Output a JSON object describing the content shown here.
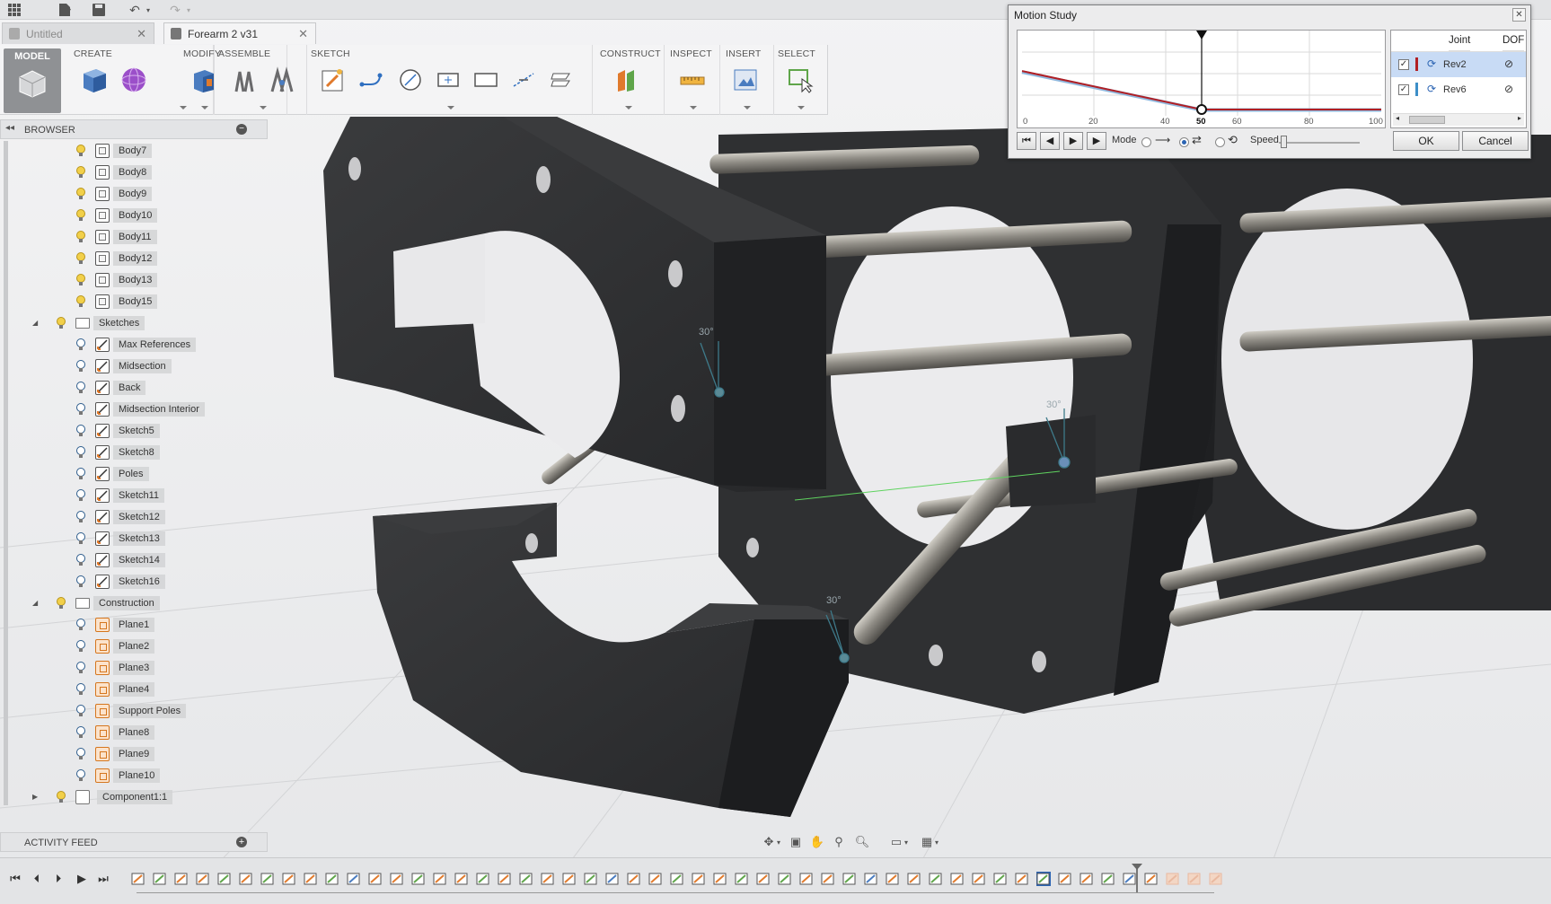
{
  "tabs": [
    {
      "label": "Untitled",
      "active": false
    },
    {
      "label": "Forearm 2 v31",
      "active": true
    }
  ],
  "toolbar": {
    "model_label": "MODEL",
    "groups": [
      "CREATE",
      "MODIFY",
      "ASSEMBLE",
      "SKETCH",
      "CONSTRUCT",
      "INSPECT",
      "INSERT",
      "SELECT"
    ]
  },
  "browser": {
    "title": "BROWSER",
    "bodies": [
      "Body7",
      "Body8",
      "Body9",
      "Body10",
      "Body11",
      "Body12",
      "Body13",
      "Body15"
    ],
    "sketches_folder": "Sketches",
    "sketches": [
      "Max References",
      "Midsection",
      "Back",
      "Midsection Interior",
      "Sketch5",
      "Sketch8",
      "Poles",
      "Sketch11",
      "Sketch12",
      "Sketch13",
      "Sketch14",
      "Sketch16"
    ],
    "construction_folder": "Construction",
    "planes": [
      "Plane1",
      "Plane2",
      "Plane3",
      "Plane4",
      "Support Poles",
      "Plane8",
      "Plane9",
      "Plane10"
    ],
    "component": "Component1:1"
  },
  "activity_feed": "ACTIVITY FEED",
  "motion_study": {
    "title": "Motion Study",
    "x_ticks": [
      "0",
      "20",
      "40",
      "50",
      "60",
      "80",
      "100"
    ],
    "marker_position": "50",
    "columns": [
      "Joint",
      "DOF"
    ],
    "joints": [
      {
        "name": "Rev2",
        "checked": true,
        "color": "#b11f24",
        "selected": true
      },
      {
        "name": "Rev6",
        "checked": true,
        "color": "#3c8ec8",
        "selected": false
      }
    ],
    "mode_label": "Mode",
    "speed_label": "Speed",
    "ok_label": "OK",
    "cancel_label": "Cancel",
    "curves": {
      "rev2": [
        [
          0,
          0.78
        ],
        [
          50,
          0.0
        ],
        [
          100,
          0.0
        ]
      ],
      "rev6": [
        [
          0,
          0.76
        ],
        [
          50,
          -0.01
        ],
        [
          100,
          -0.01
        ]
      ]
    }
  },
  "viewport": {
    "dimension_labels": [
      "30°",
      "30°",
      "30°"
    ]
  },
  "colors": {
    "accent": "#2b64b3",
    "rev2": "#b11f24",
    "rev6": "#3c8ec8",
    "body": "#2f3032"
  }
}
